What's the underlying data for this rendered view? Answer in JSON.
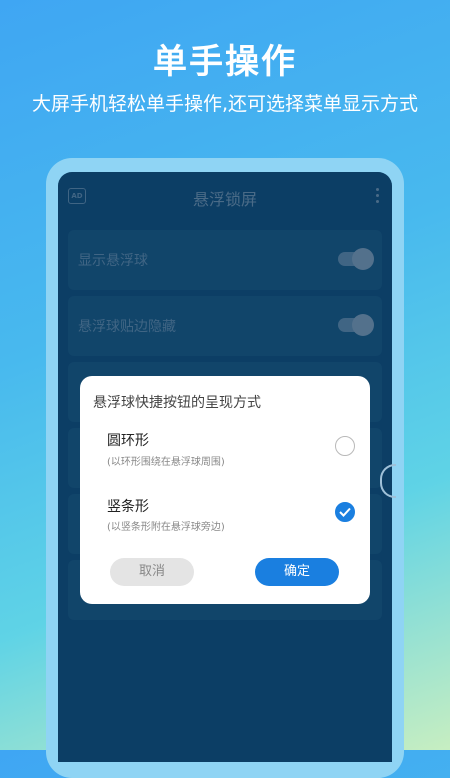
{
  "promo": {
    "title": "单手操作",
    "subtitle": "大屏手机轻松单手操作,还可选择菜单显示方式"
  },
  "app": {
    "ad_badge": "AD",
    "title": "悬浮锁屏",
    "settings": [
      {
        "label": "显示悬浮球",
        "enabled": true
      },
      {
        "label": "悬浮球贴边隐藏",
        "enabled": true
      }
    ]
  },
  "dialog": {
    "title": "悬浮球快捷按钮的呈现方式",
    "options": [
      {
        "title": "圆环形",
        "desc": "(以环形围绕在悬浮球周围)",
        "selected": false
      },
      {
        "title": "竖条形",
        "desc": "(以竖条形附在悬浮球旁边)",
        "selected": true
      }
    ],
    "cancel_label": "取消",
    "ok_label": "确定"
  },
  "colors": {
    "accent": "#1a7fe0",
    "screen_bg": "#0f4a77"
  }
}
